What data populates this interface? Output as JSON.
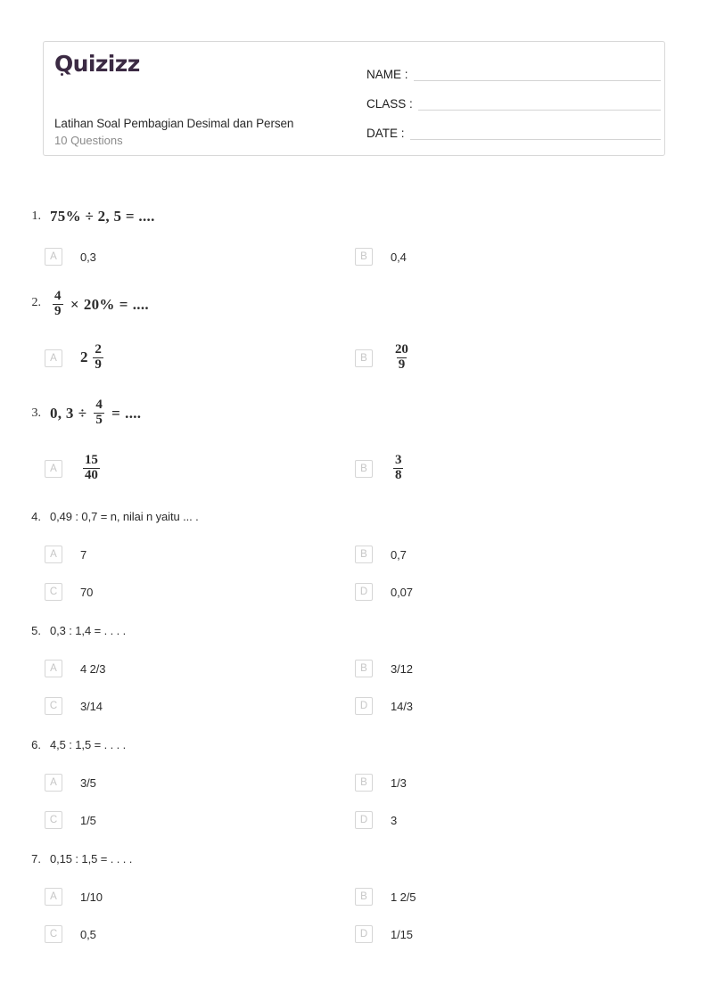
{
  "brand": {
    "logo_text": "Quizizz",
    "logo_color": "#3b2a43"
  },
  "header": {
    "title": "Latihan Soal Pembagian Desimal dan Persen",
    "subtitle": "10 Questions",
    "fields": [
      {
        "label": "NAME :",
        "value": ""
      },
      {
        "label": "CLASS :",
        "value": ""
      },
      {
        "label": "DATE :",
        "value": ""
      }
    ]
  },
  "questions": [
    {
      "number": "1.",
      "style": "math",
      "text": "75% ÷ 2, 5 = ....",
      "options": [
        {
          "letter": "A",
          "text": "0,3",
          "style": "plain"
        },
        {
          "letter": "B",
          "text": "0,4",
          "style": "plain"
        }
      ]
    },
    {
      "number": "2.",
      "style": "math",
      "parts": [
        {
          "type": "fraction",
          "num": "4",
          "den": "9"
        },
        {
          "type": "op",
          "text": "×"
        },
        {
          "type": "text",
          "text": "20%"
        },
        {
          "type": "op",
          "text": "="
        },
        {
          "type": "text",
          "text": "...."
        }
      ],
      "options": [
        {
          "letter": "A",
          "style": "mixed",
          "whole": "2",
          "num": "2",
          "den": "9"
        },
        {
          "letter": "B",
          "style": "fraction",
          "num": "20",
          "den": "9"
        }
      ]
    },
    {
      "number": "3.",
      "style": "math",
      "parts": [
        {
          "type": "text",
          "text": "0, 3"
        },
        {
          "type": "op",
          "text": "÷"
        },
        {
          "type": "fraction",
          "num": "4",
          "den": "5"
        },
        {
          "type": "op",
          "text": "="
        },
        {
          "type": "text",
          "text": "...."
        }
      ],
      "options": [
        {
          "letter": "A",
          "style": "fraction",
          "num": "15",
          "den": "40"
        },
        {
          "letter": "B",
          "style": "fraction",
          "num": "3",
          "den": "8"
        }
      ]
    },
    {
      "number": "4.",
      "style": "plain",
      "text": "0,49 : 0,7 = n, nilai n yaitu ... .",
      "options": [
        {
          "letter": "A",
          "text": "7",
          "style": "plain"
        },
        {
          "letter": "B",
          "text": "0,7",
          "style": "plain"
        },
        {
          "letter": "C",
          "text": "70",
          "style": "plain"
        },
        {
          "letter": "D",
          "text": "0,07",
          "style": "plain"
        }
      ]
    },
    {
      "number": "5.",
      "style": "plain",
      "text": "0,3 : 1,4 = . . . .",
      "options": [
        {
          "letter": "A",
          "text": "4 2/3",
          "style": "plain"
        },
        {
          "letter": "B",
          "text": "3/12",
          "style": "plain"
        },
        {
          "letter": "C",
          "text": "3/14",
          "style": "plain"
        },
        {
          "letter": "D",
          "text": "14/3",
          "style": "plain"
        }
      ]
    },
    {
      "number": "6.",
      "style": "plain",
      "text": "4,5 : 1,5 = . . . .",
      "options": [
        {
          "letter": "A",
          "text": "3/5",
          "style": "plain"
        },
        {
          "letter": "B",
          "text": "1/3",
          "style": "plain"
        },
        {
          "letter": "C",
          "text": "1/5",
          "style": "plain"
        },
        {
          "letter": "D",
          "text": "3",
          "style": "plain"
        }
      ]
    },
    {
      "number": "7.",
      "style": "plain",
      "text": "0,15 : 1,5 = . . . .",
      "options": [
        {
          "letter": "A",
          "text": "1/10",
          "style": "plain"
        },
        {
          "letter": "B",
          "text": "1 2/5",
          "style": "plain"
        },
        {
          "letter": "C",
          "text": "0,5",
          "style": "plain"
        },
        {
          "letter": "D",
          "text": "1/15",
          "style": "plain"
        }
      ]
    }
  ]
}
